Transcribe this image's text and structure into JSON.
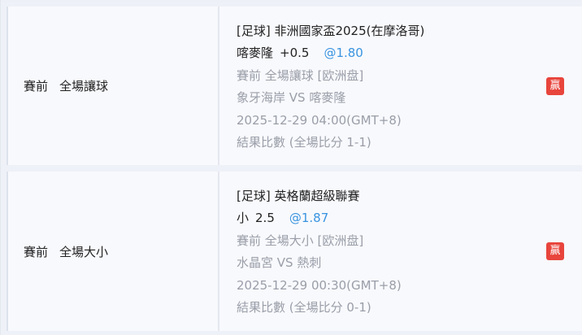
{
  "bets": [
    {
      "bet_type_phase": "賽前",
      "bet_type_market": "全場讓球",
      "league": "[足球] 非洲國家盃2025(在摩洛哥)",
      "selection": "喀麥隆",
      "line": "+0.5",
      "odds": "@1.80",
      "market_detail": "賽前 全場讓球 [欧洲盘]",
      "match": "象牙海岸 VS 喀麥隆",
      "datetime": "2025-12-29 04:00(GMT+8)",
      "result": "結果比數 (全場比分 1-1)",
      "status": "贏"
    },
    {
      "bet_type_phase": "賽前",
      "bet_type_market": "全場大小",
      "league": "[足球] 英格蘭超級聯賽",
      "selection": "小",
      "line": "2.5",
      "odds": "@1.87",
      "market_detail": "賽前 全場大小 [欧洲盘]",
      "match": "水晶宮 VS 熱刺",
      "datetime": "2025-12-29 00:30(GMT+8)",
      "result": "結果比數 (全場比分 0-1)",
      "status": "贏"
    }
  ],
  "colors": {
    "odds": "#3a94e0",
    "win_badge": "#e8453c",
    "muted_text": "#9a9ea8"
  }
}
